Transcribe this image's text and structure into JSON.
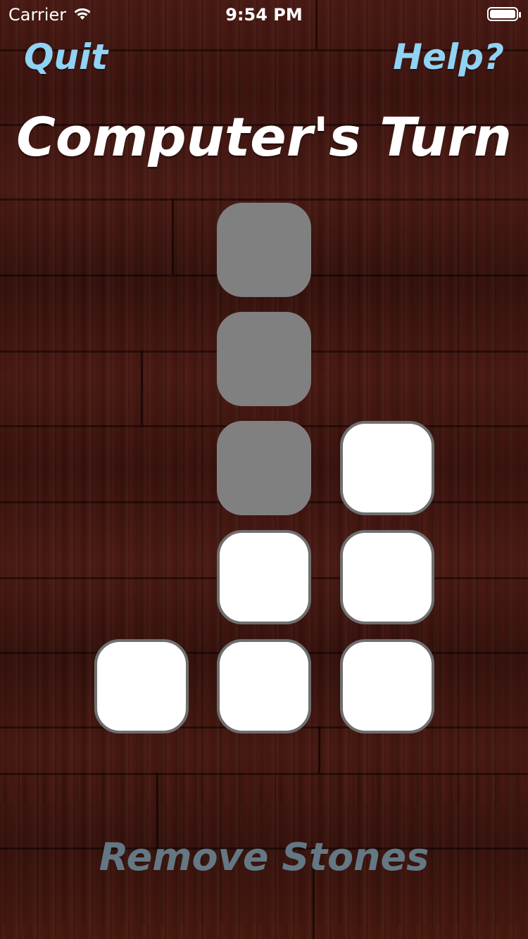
{
  "status_bar": {
    "carrier": "Carrier",
    "time": "9:54 PM"
  },
  "nav": {
    "quit_label": "Quit",
    "help_label": "Help?"
  },
  "title": "Computer's Turn",
  "board": {
    "columns": [
      {
        "stones": [
          "present"
        ]
      },
      {
        "stones": [
          "removed",
          "removed",
          "removed",
          "present",
          "present"
        ]
      },
      {
        "stones": [
          "present",
          "present",
          "present"
        ]
      }
    ]
  },
  "actions": {
    "remove_label": "Remove Stones",
    "remove_enabled": false
  },
  "colors": {
    "link": "#8fd3f5",
    "title": "#ffffff",
    "stone_present": "#ffffff",
    "stone_removed": "#808080",
    "button_disabled": "#6c8a99"
  }
}
